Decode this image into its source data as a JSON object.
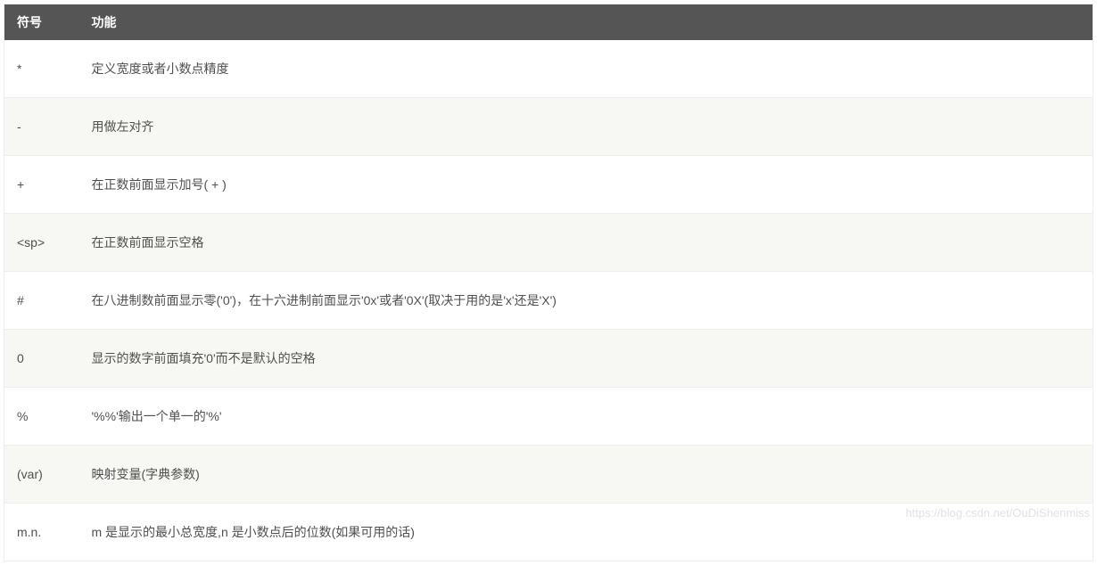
{
  "table": {
    "headers": [
      "符号",
      "功能"
    ],
    "rows": [
      {
        "symbol": "*",
        "function": "定义宽度或者小数点精度"
      },
      {
        "symbol": "-",
        "function": "用做左对齐"
      },
      {
        "symbol": "+",
        "function": "在正数前面显示加号( + )"
      },
      {
        "symbol": "<sp>",
        "function": "在正数前面显示空格"
      },
      {
        "symbol": "#",
        "function": "在八进制数前面显示零('0')，在十六进制前面显示'0x'或者'0X'(取决于用的是'x'还是'X')"
      },
      {
        "symbol": "0",
        "function": "显示的数字前面填充'0'而不是默认的空格"
      },
      {
        "symbol": "%",
        "function": "'%%'输出一个单一的'%'"
      },
      {
        "symbol": "(var)",
        "function": "映射变量(字典参数)"
      },
      {
        "symbol": "m.n.",
        "function": "m 是显示的最小总宽度,n 是小数点后的位数(如果可用的话)"
      }
    ]
  },
  "watermark": "https://blog.csdn.net/OuDiShenmiss"
}
